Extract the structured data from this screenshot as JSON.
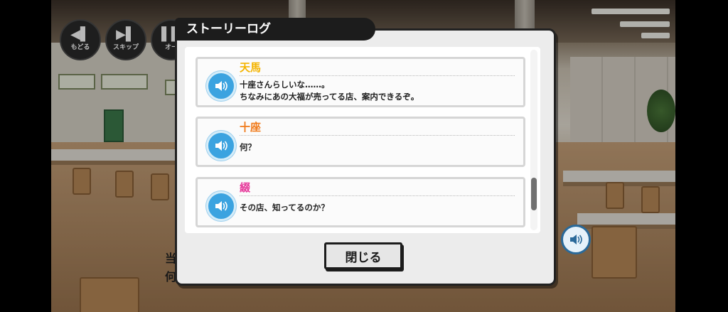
{
  "controls": {
    "back_label": "もどる",
    "skip_label": "スキップ",
    "auto_label": "オー"
  },
  "background_dialog": {
    "line1": "当",
    "line2": "何"
  },
  "story_log": {
    "title": "ストーリーログ",
    "entries": [
      {
        "speaker": "天馬",
        "speaker_color": "#f4b400",
        "lines": [
          "十座さんらしいな……。",
          "ちなみにあの大福が売ってる店、案内できるぞ。"
        ]
      },
      {
        "speaker": "十座",
        "speaker_color": "#f07a1a",
        "lines": [
          "何？"
        ]
      },
      {
        "speaker": "綴",
        "speaker_color": "#e6389a",
        "lines": [
          "その店、知ってるのか？"
        ]
      }
    ],
    "close_label": "閉じる"
  },
  "icons": {
    "voice": "speaker-icon",
    "back": "rewind-icon",
    "skip": "skip-icon",
    "auto": "auto-play-icon"
  }
}
